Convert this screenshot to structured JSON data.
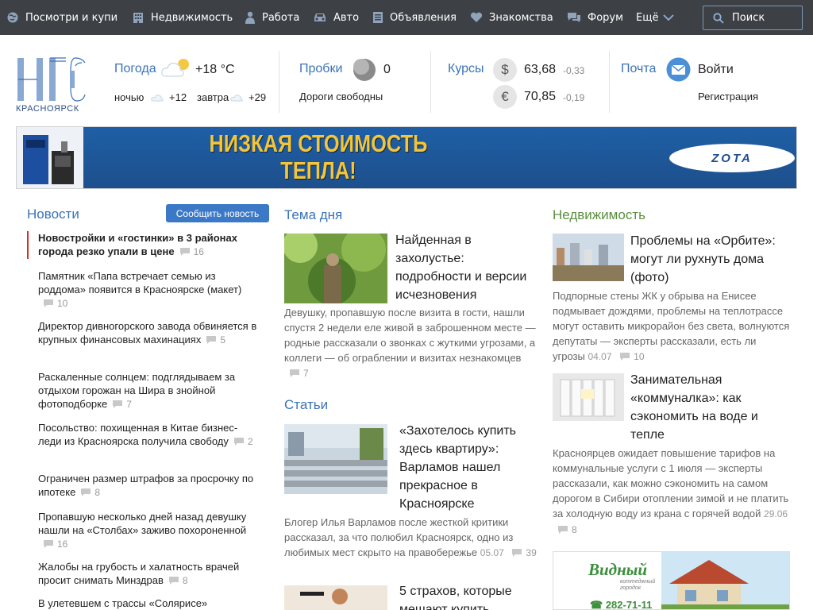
{
  "nav": {
    "items": [
      {
        "label": "Посмотри и купи",
        "icon": "globe-icon"
      },
      {
        "label": "Недвижимость",
        "icon": "building-icon"
      },
      {
        "label": "Работа",
        "icon": "worker-icon"
      },
      {
        "label": "Авто",
        "icon": "car-icon"
      },
      {
        "label": "Объявления",
        "icon": "list-icon"
      },
      {
        "label": "Знакомства",
        "icon": "heart-icon"
      },
      {
        "label": "Форум",
        "icon": "chat-icon"
      }
    ],
    "more_label": "Ещё",
    "search_label": "Поиск"
  },
  "header": {
    "logo_text": "НГС",
    "city": "КРАСНОЯРСК",
    "weather": {
      "label": "Погода",
      "temp": "+18 °C",
      "night_label": "ночью",
      "night_temp": "+12",
      "tomorrow_label": "завтра",
      "tomorrow_temp": "+29"
    },
    "traffic": {
      "label": "Пробки",
      "score": "0",
      "status": "Дороги свободны"
    },
    "rates": {
      "label": "Курсы",
      "usd_symbol": "$",
      "usd": "63,68",
      "usd_change": "-0,33",
      "eur_symbol": "€",
      "eur": "70,85",
      "eur_change": "-0,19"
    },
    "mail": {
      "label": "Почта",
      "login": "Войти",
      "register": "Регистрация"
    }
  },
  "banner": {
    "line1": "НИЗКАЯ СТОИМОСТЬ",
    "line2": "ТЕПЛА!",
    "brand": "ZOTA"
  },
  "news": {
    "title": "Новости",
    "report_label": "Сообщить новость",
    "items": [
      {
        "text": "Новостройки и «гостинки» в 3 районах города резко упали в цене",
        "comments": "16"
      },
      {
        "text": "Памятник «Папа встречает семью из роддома» появится в Красноярске (макет)",
        "comments": "10"
      },
      {
        "text": "Директор дивногорского завода обвиняется в крупных финансовых махинациях",
        "comments": "5"
      },
      {
        "text": "Раскаленные солнцем: подглядываем за отдыхом горожан на Шира в знойной фотоподборке",
        "comments": "7"
      },
      {
        "text": "Посольство: похищенная в Китае бизнес-леди из Красноярска получила свободу",
        "comments": "2"
      },
      {
        "text": "Ограничен размер штрафов за просрочку по ипотеке",
        "comments": "8"
      },
      {
        "text": "Пропавшую несколько дней назад девушку нашли на «Столбах» заживо похороненной",
        "comments": "16"
      },
      {
        "text": "Жалобы на грубость и халатность врачей просит снимать Минздрав",
        "comments": "8"
      },
      {
        "text": "В улетевшем с трассы «Солярисе»",
        "comments": ""
      }
    ]
  },
  "theme": {
    "title": "Тема дня",
    "article": {
      "title": "Найденная в захолустье: подробности и версии исчезновения",
      "desc": "Девушку, пропавшую после визита в гости, нашли спустя 2 недели еле живой в заброшенном месте — родные рассказали о звонках с жуткими угрозами, а коллеги — об ограблении и визитах незнакомцев",
      "comments": "7"
    }
  },
  "articles": {
    "title": "Статьи",
    "items": [
      {
        "title": "«Захотелось купить здесь квартиру»: Варламов нашел прекрасное в Красноярске",
        "desc": "Блогер Илья Варламов после жесткой критики рассказал, за что полюбил Красноярск, одно из любимых мест скрыто на правобережье",
        "date": "05.07",
        "comments": "39"
      },
      {
        "title": "5 страхов, которые мешают купить",
        "desc": "",
        "date": "",
        "comments": ""
      }
    ]
  },
  "realty": {
    "title": "Недвижимость",
    "items": [
      {
        "title": "Проблемы на «Орбите»: могут ли рухнуть дома (фото)",
        "desc": "Подпорные стены ЖК у обрыва на Енисее подмывает дождями, проблемы на теплотрассе могут оставить микрорайон без света, волнуются депутаты — эксперты рассказали, есть ли угрозы",
        "date": "04.07",
        "comments": "10"
      },
      {
        "title": "Занимательная «коммуналка»: как сэкономить на воде и тепле",
        "desc": "Красноярцев ожидает повышение тарифов на коммунальные услуги с 1 июля — эксперты рассказали, как можно сэкономить на самом дорогом в Сибири отоплении зимой и не платить за холодную воду из крана с горячей водой",
        "date": "29.06",
        "comments": "8"
      }
    ],
    "ad": {
      "brand": "Видный",
      "tagline": "коттеджный городок",
      "phone": "282-71-11"
    }
  }
}
